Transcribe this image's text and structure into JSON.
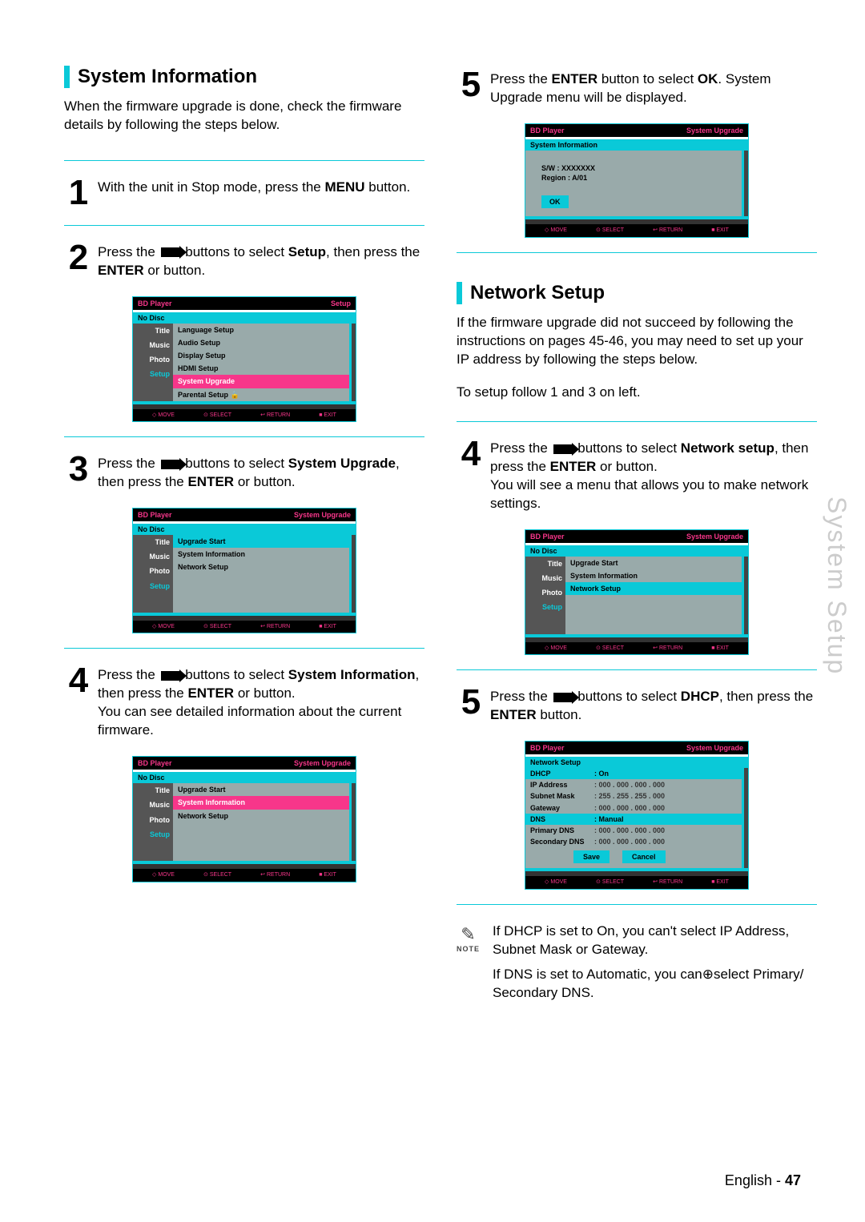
{
  "side_tab": "System Setup",
  "footer": {
    "lang": "English",
    "sep": " - ",
    "page": "47"
  },
  "arrows_glyph": "▮▸",
  "left": {
    "heading": "System Information",
    "intro": "When the firmware upgrade is done, check the firmware details by following the steps below.",
    "step1": {
      "num": "1",
      "pre": "With the unit in Stop mode, press the ",
      "bold1": "MENU",
      "post": " button."
    },
    "step2": {
      "num": "2",
      "a": "Press the ",
      "b": " buttons to select ",
      "bold1": "Setup",
      "c": ", then press the ",
      "bold2": "ENTER",
      "d": " or      button."
    },
    "step3": {
      "num": "3",
      "a": "Press the ",
      "b": " buttons to select ",
      "bold1": "System Upgrade",
      "c": ", then press the ",
      "bold2": "ENTER",
      "d": " or      button."
    },
    "step4": {
      "num": "4",
      "a": "Press the ",
      "b": " buttons to select ",
      "bold1": "System Information",
      "c": ", then press the ",
      "bold2": "ENTER",
      "d": " or      button.",
      "extra": "You can see detailed information about the current firmware."
    }
  },
  "right": {
    "step5": {
      "num": "5",
      "a": "Press the ",
      "bold1": "ENTER",
      "b": " button to select ",
      "bold2": "OK",
      "c": ". System Upgrade menu will be displayed."
    },
    "heading": "Network Setup",
    "intro": "If the firmware upgrade did not succeed by following the instructions on pages 45-46, you may need to set up your IP address by following the steps below.",
    "sub": "To setup follow 1 and 3 on left.",
    "step4b": {
      "num": "4",
      "a": "Press the ",
      "b": " buttons to select ",
      "bold1": "Network setup",
      "c": ", then press the ",
      "bold2": "ENTER",
      "d": " or      button.",
      "extra": "You will see a menu that allows you to make network settings."
    },
    "step5b": {
      "num": "5",
      "a": "Press the ",
      "b": " buttons to select ",
      "bold1": "DHCP",
      "c": ", then press the ",
      "bold2": "ENTER",
      "d": " button."
    },
    "note_label": "NOTE",
    "note1": "If DHCP is set to On, you can't select IP Address, Subnet Mask or Gateway.",
    "note2": "If DNS is set to Automatic, you can⊕select Primary/ Secondary DNS."
  },
  "osd": {
    "topbar_left": "BD Player",
    "topbar_setup": "Setup",
    "topbar_sys": "System Upgrade",
    "nodisc": "No Disc",
    "side_items": [
      "Title",
      "Music",
      "Photo",
      "Setup"
    ],
    "btnbar": [
      "◇ MOVE",
      "⊙ SELECT",
      "↩ RETURN",
      "■ EXIT"
    ],
    "menu1": [
      "Language Setup",
      "Audio Setup",
      "Display Setup",
      "HDMI Setup",
      "System Upgrade",
      "Parental Setup  🔒"
    ],
    "menu1_hl": 4,
    "menu2": [
      "Upgrade Start",
      "System Information",
      "Network Setup"
    ],
    "menu2a_hl": 0,
    "menu2b_hl": 1,
    "menu2c_hl": 2,
    "sysinfo": {
      "title": "System Information",
      "sw": "S/W : XXXXXXX",
      "region": "Region : A/01",
      "ok": "OK"
    },
    "netsetup": {
      "title": "Network Setup",
      "rows": [
        {
          "lbl": "DHCP",
          "val": ": On",
          "hl": true
        },
        {
          "lbl": "IP Address",
          "val": ":  000  . 000  . 000  . 000"
        },
        {
          "lbl": "Subnet Mask",
          "val": ":  255  . 255  . 255  . 000"
        },
        {
          "lbl": "Gateway",
          "val": ":  000  . 000  . 000  . 000"
        },
        {
          "lbl": "DNS",
          "val": ": Manual",
          "hl": true
        },
        {
          "lbl": "Primary DNS",
          "val": ":  000  . 000  . 000  . 000"
        },
        {
          "lbl": "Secondary DNS",
          "val": ":  000  . 000  . 000  . 000"
        }
      ],
      "save": "Save",
      "cancel": "Cancel"
    }
  }
}
